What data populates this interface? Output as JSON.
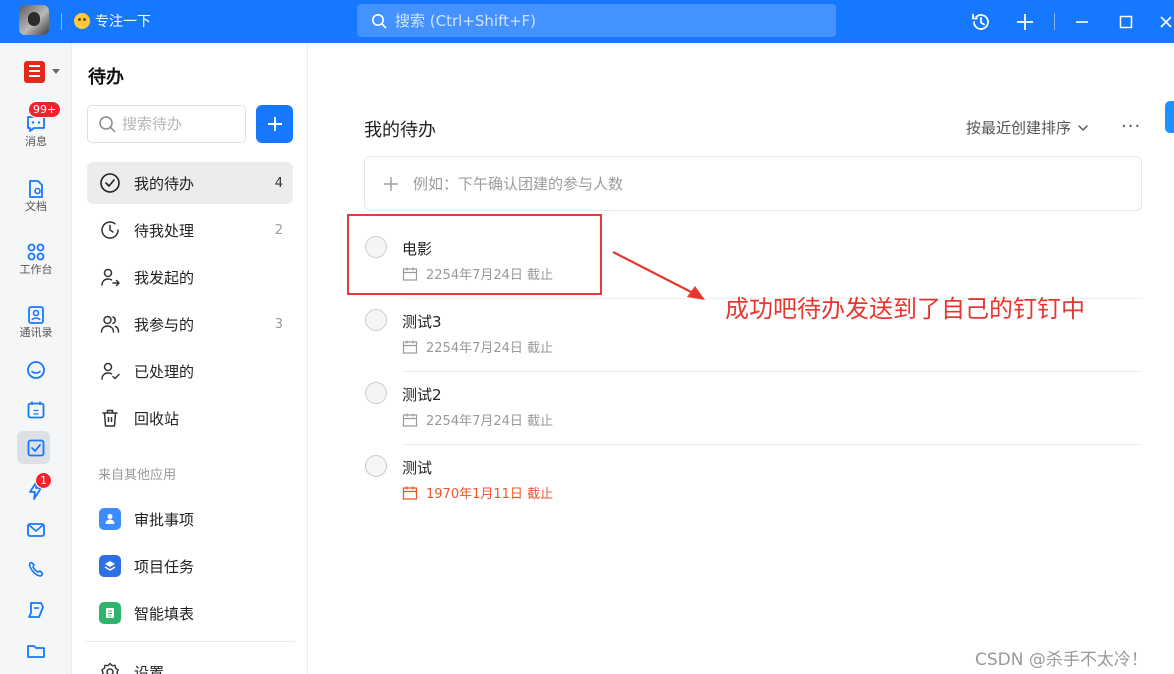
{
  "titlebar": {
    "focus_label": "专注一下",
    "search_placeholder": "搜索 (Ctrl+Shift+F)"
  },
  "rail": {
    "items": [
      {
        "label": "消息",
        "badge": "99+"
      },
      {
        "label": "文档"
      },
      {
        "label": "工作台"
      },
      {
        "label": "通讯录"
      },
      {
        "badge": "1"
      }
    ]
  },
  "sidebar": {
    "title": "待办",
    "search_placeholder": "搜索待办",
    "items": [
      {
        "label": "我的待办",
        "count": "4"
      },
      {
        "label": "待我处理",
        "count": "2"
      },
      {
        "label": "我发起的",
        "count": ""
      },
      {
        "label": "我参与的",
        "count": "3"
      },
      {
        "label": "已处理的",
        "count": ""
      },
      {
        "label": "回收站",
        "count": ""
      }
    ],
    "section_label": "来自其他应用",
    "apps": [
      {
        "label": "审批事项",
        "color": "#3d8bff"
      },
      {
        "label": "项目任务",
        "color": "#2f6fe4"
      },
      {
        "label": "智能填表",
        "color": "#2fb46e"
      }
    ],
    "settings_label": "设置"
  },
  "main": {
    "title": "我的待办",
    "sort_label": "按最近创建排序",
    "more_label": "···",
    "add_placeholder": "例如：下午确认团建的参与人数",
    "tasks": [
      {
        "title": "电影",
        "due": "2254年7月24日 截止",
        "overdue": false
      },
      {
        "title": "测试3",
        "due": "2254年7月24日 截止",
        "overdue": false
      },
      {
        "title": "测试2",
        "due": "2254年7月24日 截止",
        "overdue": false
      },
      {
        "title": "测试",
        "due": "1970年1月11日 截止",
        "overdue": true
      }
    ]
  },
  "annotation": {
    "text": "成功吧待办发送到了自己的钉钉中",
    "color": "#e8372f"
  },
  "watermark": "CSDN @杀手不太冷！",
  "colors": {
    "accent": "#1677ff",
    "overdue": "#f0542d",
    "badge": "#f5222d"
  }
}
